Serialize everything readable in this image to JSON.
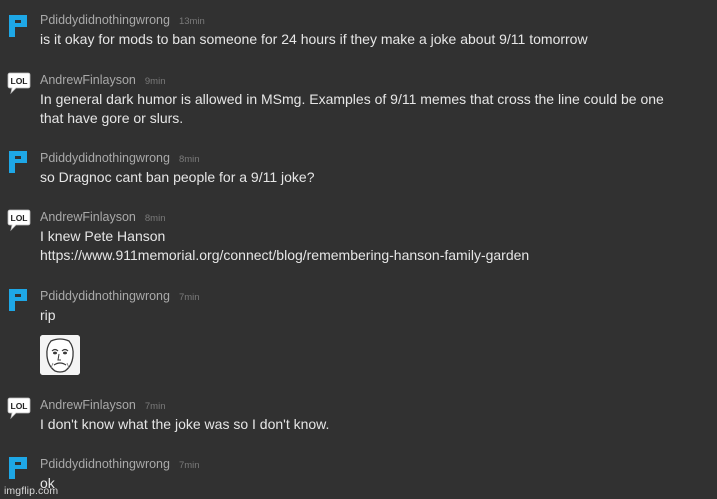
{
  "messages": [
    {
      "username": "Pdiddydidnothingwrong",
      "time": "13min",
      "avatar": "blue-p-icon",
      "lines": [
        "is it okay for mods to ban someone for 24 hours if they make a joke about 9/11 tomorrow"
      ]
    },
    {
      "username": "AndrewFinlayson",
      "time": "9min",
      "avatar": "lol-bubble-icon",
      "lines": [
        "In general dark humor is allowed in MSmg. Examples of 9/11 memes that cross the line could be one",
        "that have gore or slurs."
      ]
    },
    {
      "username": "Pdiddydidnothingwrong",
      "time": "8min",
      "avatar": "blue-p-icon",
      "lines": [
        "so Dragnoc cant ban people for a 9/11 joke?"
      ]
    },
    {
      "username": "AndrewFinlayson",
      "time": "8min",
      "avatar": "lol-bubble-icon",
      "lines": [
        "I knew Pete Hanson",
        "https://www.911memorial.org/connect/blog/remembering-hanson-family-garden"
      ]
    },
    {
      "username": "Pdiddydidnothingwrong",
      "time": "7min",
      "avatar": "blue-p-icon",
      "lines": [
        "rip"
      ],
      "sticker": "sad-meme-face-icon"
    },
    {
      "username": "AndrewFinlayson",
      "time": "7min",
      "avatar": "lol-bubble-icon",
      "lines": [
        "I don't know what the joke was so I don't know."
      ]
    },
    {
      "username": "Pdiddydidnothingwrong",
      "time": "7min",
      "avatar": "blue-p-icon",
      "lines": [
        "ok"
      ]
    }
  ],
  "watermark": "imgflip.com",
  "colors": {
    "background": "#313131",
    "message_text": "#e6e6e6",
    "username": "#a9a9a9",
    "timestamp": "#7a7a7a",
    "p_icon": "#1ea7e6"
  }
}
